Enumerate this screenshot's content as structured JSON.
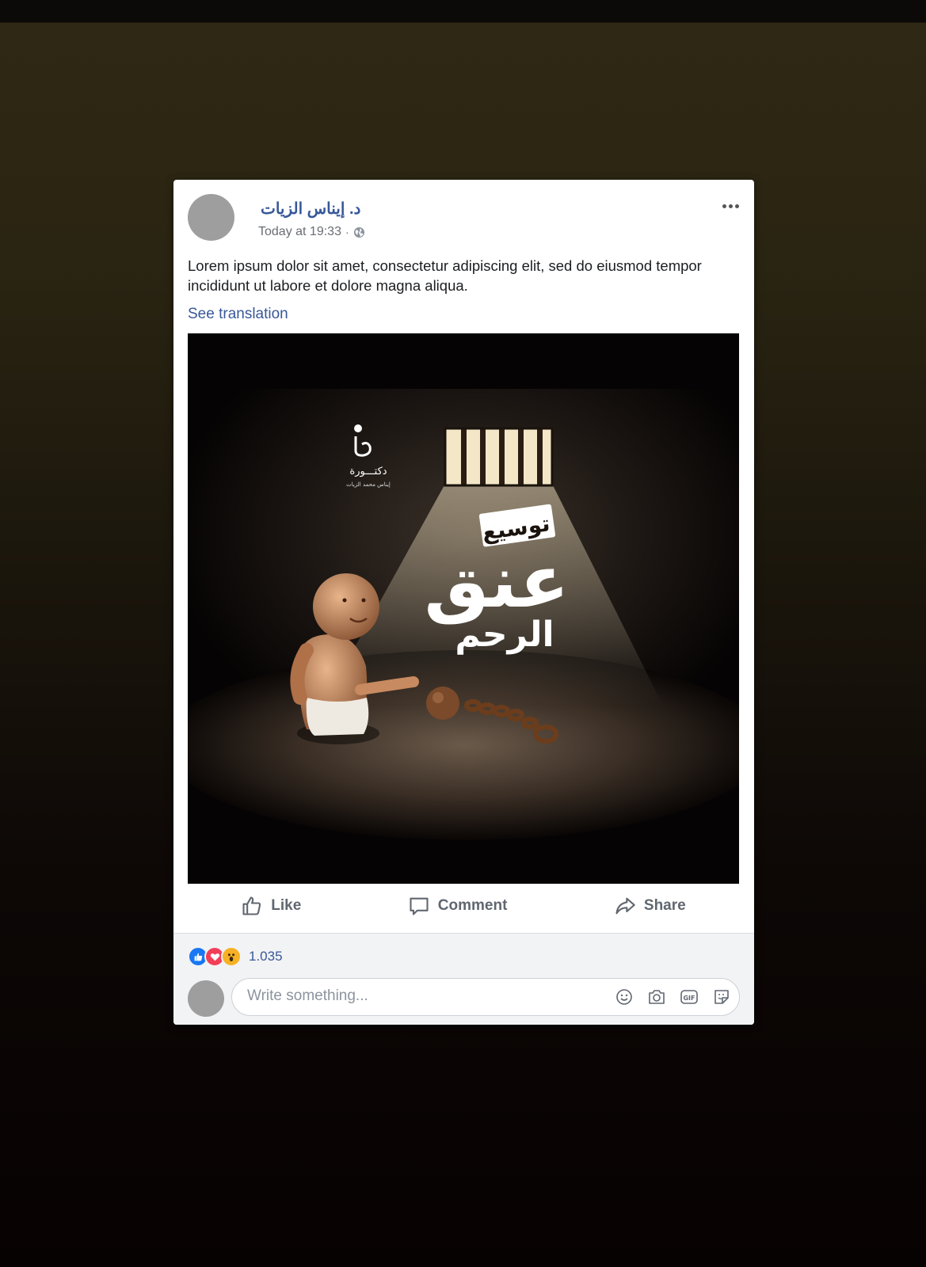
{
  "post": {
    "author": "د. إيناس الزيات",
    "timestamp": "Today at 19:33",
    "separator": "·",
    "privacy_icon": "globe-icon",
    "text": "Lorem ipsum dolor sit amet, consectetur adipiscing elit, sed do eiusmod tempor incididunt ut labore et dolore magna aliqua.",
    "see_translation": "See translation"
  },
  "media": {
    "logo_title": "دكتـــورة",
    "logo_subtitle": "إيناس محمد الزيات",
    "headline_tag": "توسيع",
    "headline_main": "عنق",
    "headline_sub": "الرحم"
  },
  "actions": {
    "like": "Like",
    "comment": "Comment",
    "share": "Share"
  },
  "reactions": {
    "icons": [
      "like-reaction-icon",
      "love-reaction-icon",
      "wow-reaction-icon"
    ],
    "count": "1.035"
  },
  "comment_box": {
    "placeholder": "Write something...",
    "icons": [
      "emoji-icon",
      "camera-icon",
      "gif-icon",
      "sticker-icon"
    ]
  },
  "colors": {
    "link": "#385898",
    "author": "#365899",
    "like_blue": "#1877f2",
    "love_red": "#f33e58",
    "wow_yellow": "#f7b125"
  }
}
